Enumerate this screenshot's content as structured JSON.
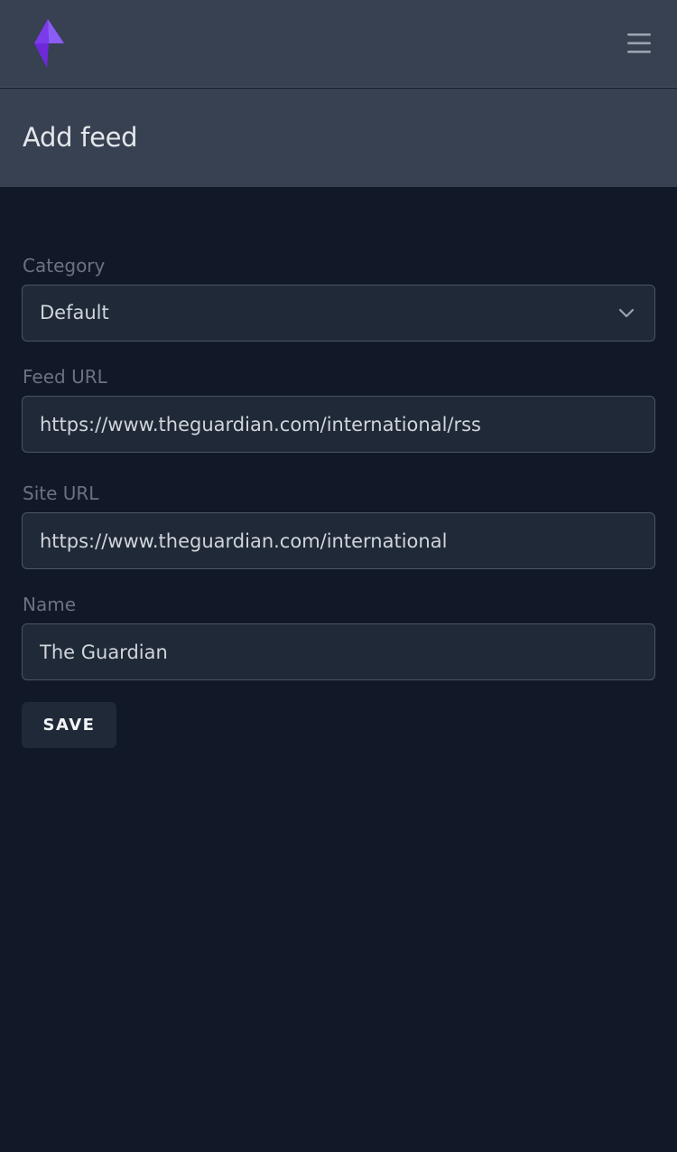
{
  "topbar": {
    "logo_icon": "app-logo-icon",
    "menu_icon": "hamburger-menu-icon",
    "accent_color": "#7c3aed"
  },
  "page": {
    "title": "Add feed"
  },
  "form": {
    "category": {
      "label": "Category",
      "value": "Default"
    },
    "feed_url": {
      "label": "Feed URL",
      "value": "https://www.theguardian.com/international/rss"
    },
    "site_url": {
      "label": "Site URL",
      "value": "https://www.theguardian.com/international"
    },
    "name": {
      "label": "Name",
      "value": "The Guardian"
    },
    "save_label": "SAVE"
  }
}
